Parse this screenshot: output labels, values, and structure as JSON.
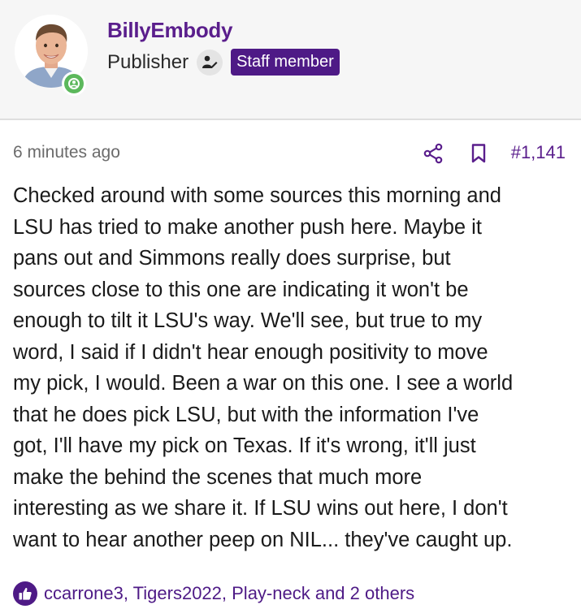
{
  "author": {
    "username": "BillyEmbody",
    "role": "Publisher",
    "badge": "Staff member",
    "avatar_icon": "user-avatar-photo",
    "status_icon": "online-status-icon"
  },
  "post": {
    "timestamp": "6 minutes ago",
    "number": "#1,141",
    "share_icon": "share-icon",
    "bookmark_icon": "bookmark-icon",
    "body": "Checked around with some sources this morning and\nLSU has tried to make another push here. Maybe it\npans out and Simmons really does surprise, but\nsources close to this one are indicating it won't be\nenough to tilt it LSU's way. We'll see, but true to my\nword, I said if I didn't hear enough positivity to move\nmy pick, I would. Been a war on this one. I see a world\nthat he does pick LSU, but with the information I've\ngot, I'll have my pick on Texas. If it's wrong, it'll just\nmake the behind the scenes that much more\ninteresting as we share it. If LSU wins out here, I don't\nwant to hear another peep on NIL... they've caught up."
  },
  "reactions": {
    "icon": "thumbs-up-icon",
    "text": "ccarrone3, Tigers2022, Play-neck and 2 others"
  },
  "colors": {
    "accent": "#5a1e8c",
    "badge_bg": "#4e1a86",
    "online": "#5cb85c",
    "header_bg": "#f6f6f6"
  }
}
